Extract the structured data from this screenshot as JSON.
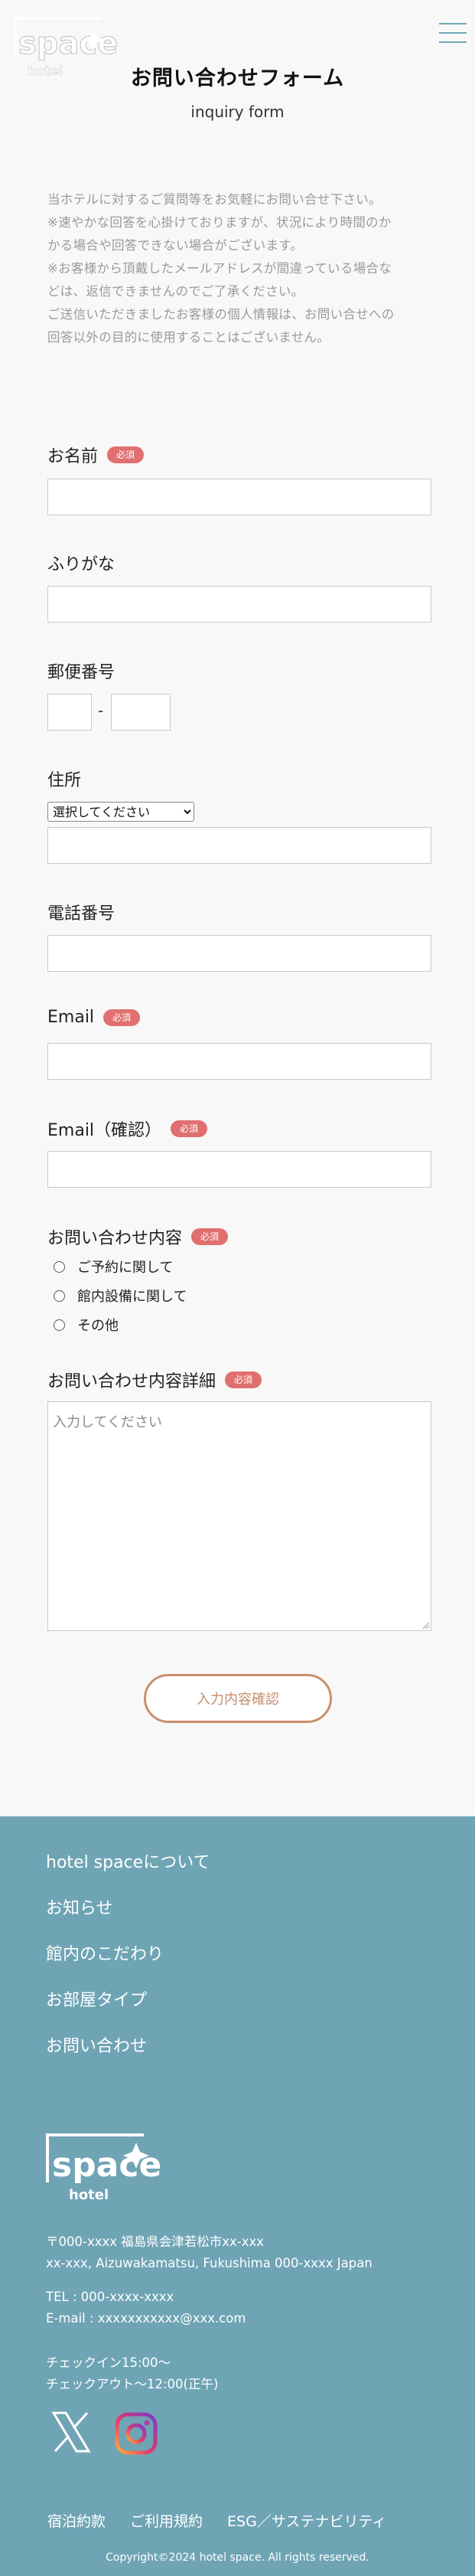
{
  "header": {
    "logo_text": "space",
    "logo_sub": "hotel",
    "title": "お問い合わせフォーム",
    "subtitle": "inquiry form"
  },
  "intro": [
    "当ホテルに対するご質問等をお気軽にお問い合せ下さい。",
    "※速やかな回答を心掛けておりますが、状況により時間のか",
    "かる場合や回答できない場合がございます。",
    "※お客様から頂戴したメールアドレスが間違っている場合な",
    "どは、返信できませんのでご了承ください。",
    "ご送信いただきましたお客様の個人情報は、お問い合せへの",
    "回答以外の目的に使用することはございません。"
  ],
  "form": {
    "required_badge": "必須",
    "name_label": "お名前",
    "furigana_label": "ふりがな",
    "zip_label": "郵便番号",
    "zip_separator": "-",
    "address_label": "住所",
    "prefecture_select": "選択してください",
    "phone_label": "電話番号",
    "email_label": "Email",
    "email_confirm_label": "Email（確認）",
    "inquiry_label": "お問い合わせ内容",
    "inquiry_options": [
      "ご予約に関して",
      "館内設備に関して",
      "その他"
    ],
    "detail_label": "お問い合わせ内容詳細",
    "detail_placeholder": "入力してください",
    "confirm_button": "入力内容確認"
  },
  "footer": {
    "nav": [
      "hotel spaceについて",
      "お知らせ",
      "館内のこだわり",
      "お部屋タイプ",
      "お問い合わせ"
    ],
    "logo_text": "space",
    "logo_sub": "hotel",
    "address_jp": "〒000-xxxx 福島県会津若松市xx-xxx",
    "address_en": "xx-xxx, Aizuwakamatsu, Fukushima 000-xxxx Japan",
    "tel": "TEL : 000-xxxx-xxxx",
    "email": "E-mail : xxxxxxxxxxx@xxx.com",
    "checkin": "チェックイン15:00〜",
    "checkout": "チェックアウト〜12:00(正午)",
    "legal": [
      "宿泊約款",
      "ご利用規約",
      "ESG／サステナビリティ"
    ],
    "copyright": "Copyright©2024 hotel space. All rights reserved."
  },
  "colors": {
    "background": "#f8f8f8",
    "footer": "#6fa4b5",
    "required_badge": "#e06f6f",
    "button_border": "#c98f6b",
    "hamburger": "#6fa7b8"
  }
}
